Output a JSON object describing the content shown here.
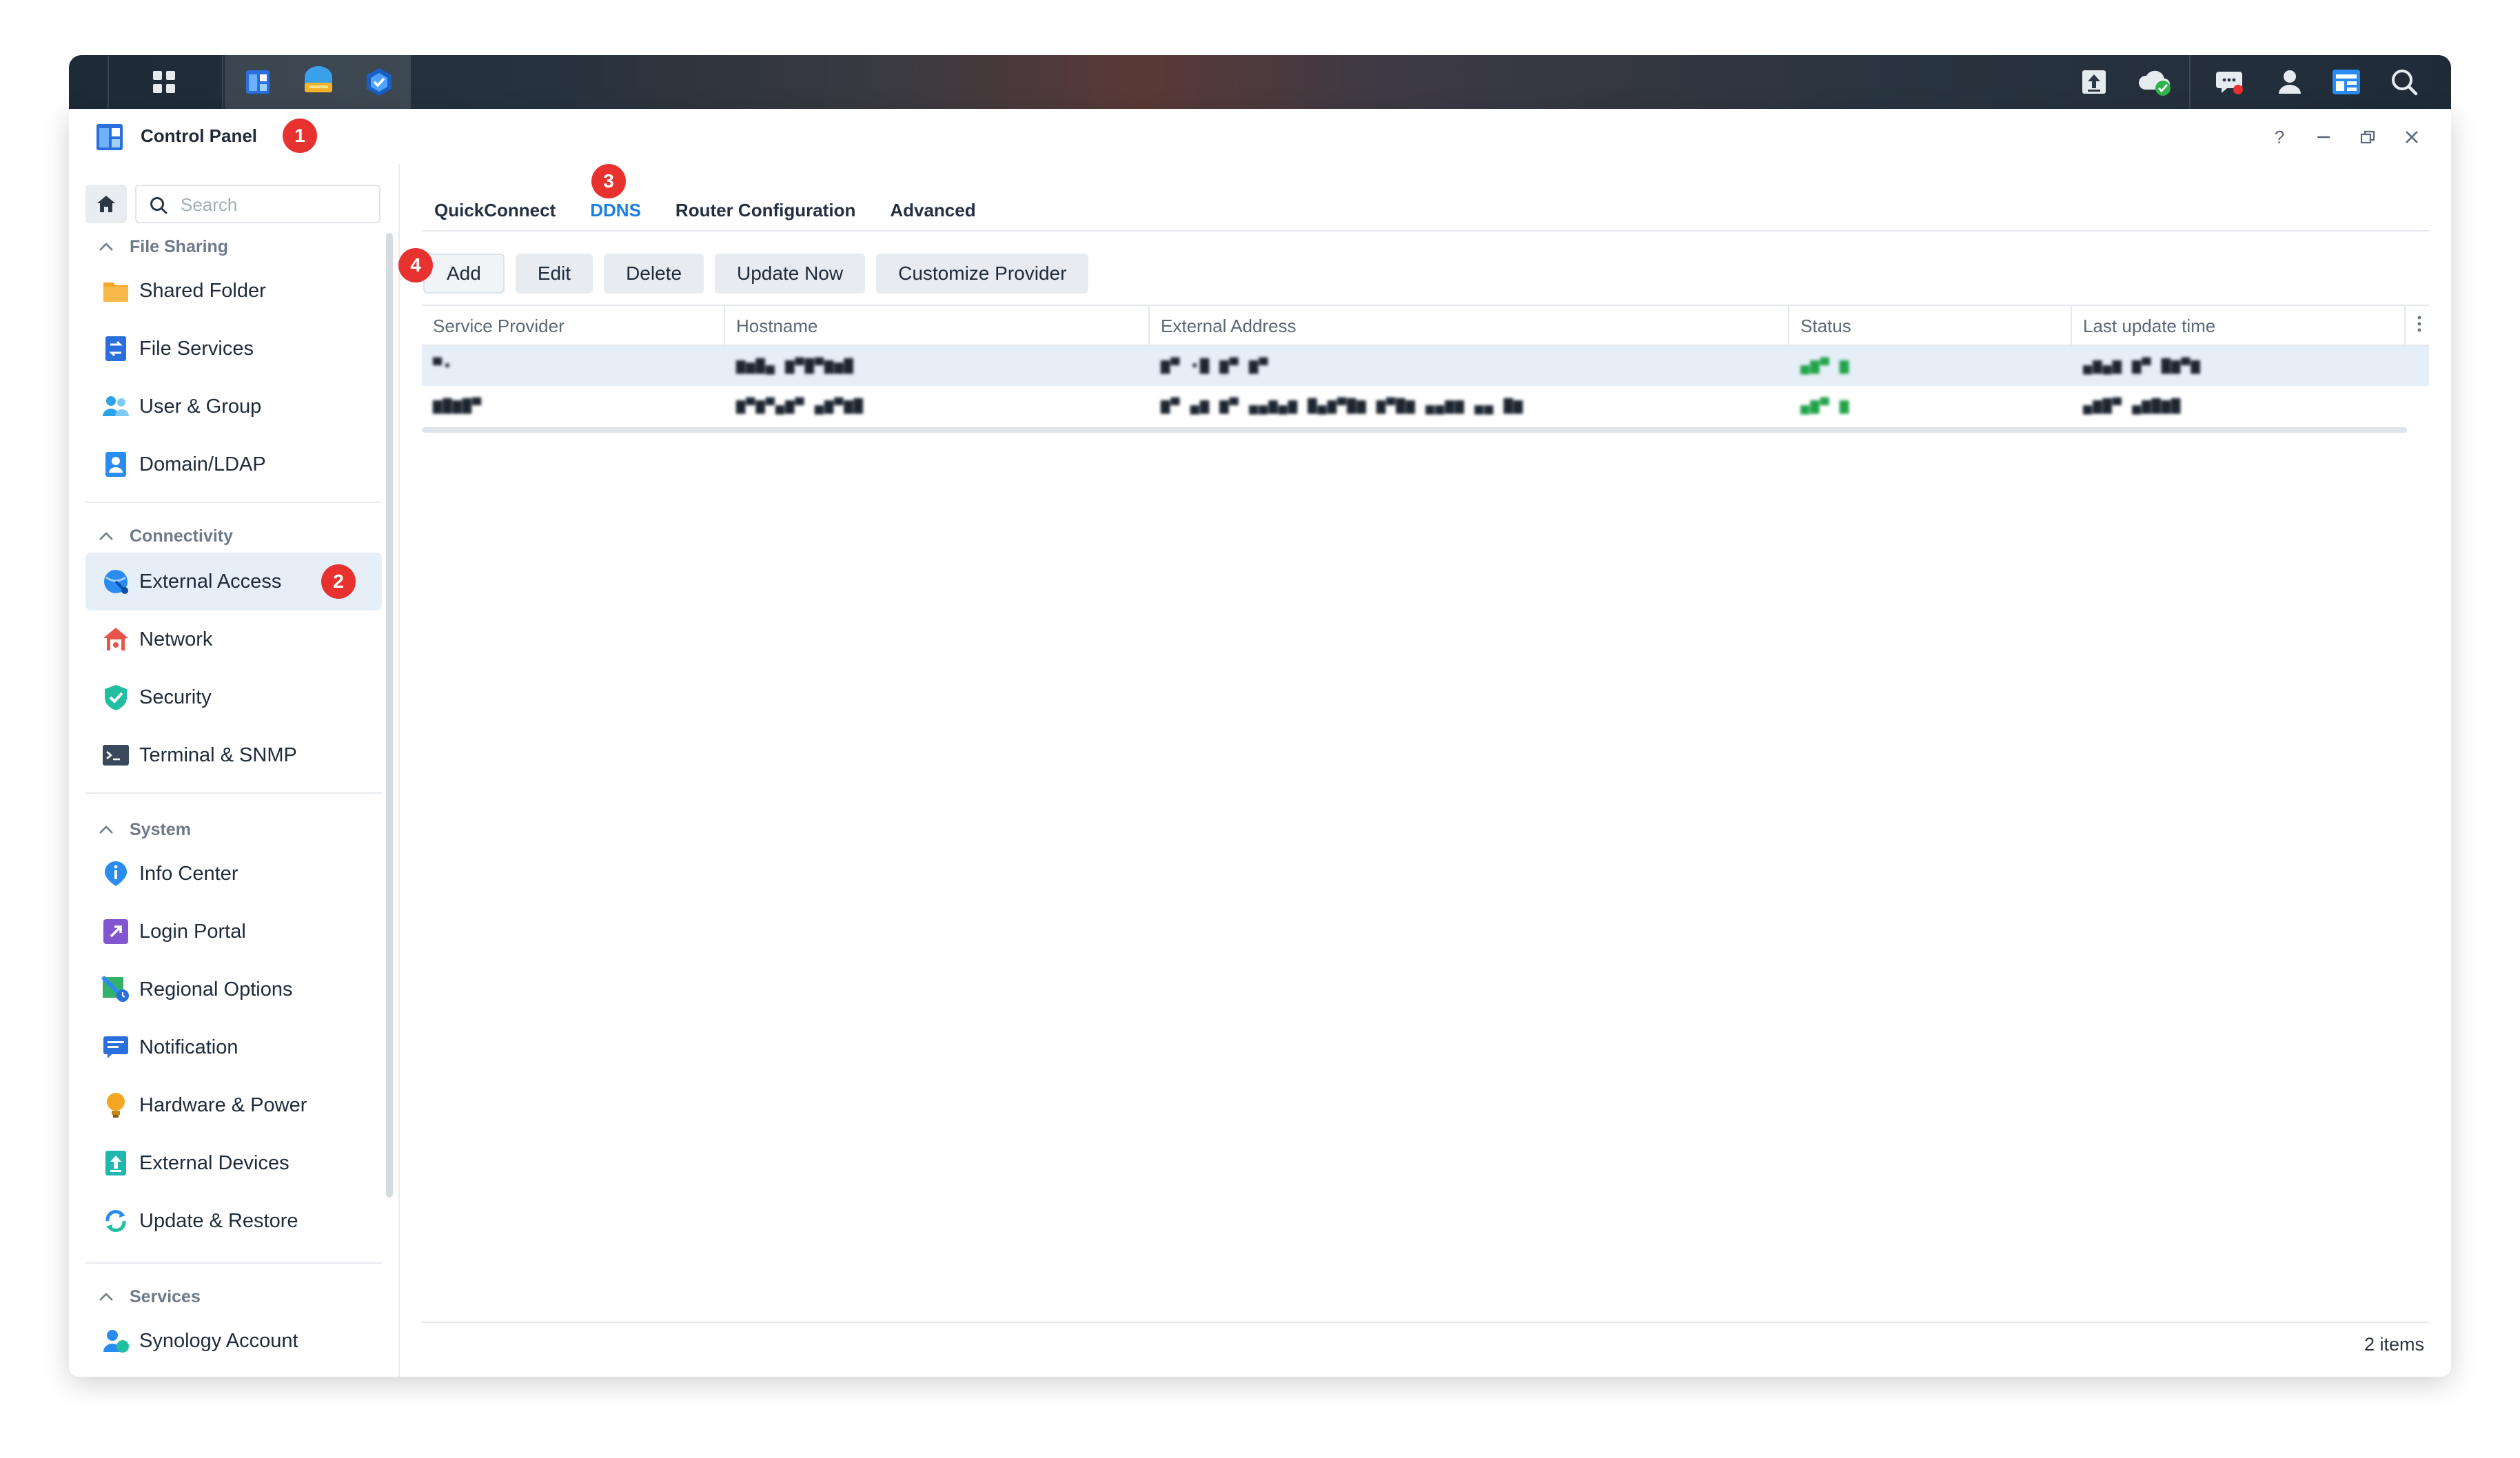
{
  "taskbar": {
    "left_icons": [
      "apps-grid-icon",
      "control-panel-icon",
      "file-station-icon",
      "security-advisor-icon"
    ],
    "right_icons": [
      "upload-icon",
      "cloud-sync-icon",
      "notifications-icon",
      "user-icon",
      "widgets-icon",
      "search-icon"
    ]
  },
  "window": {
    "title": "Control Panel",
    "controls": {
      "help": "?",
      "minimize": "—",
      "restore": "❐",
      "close": "✕"
    }
  },
  "annotations": {
    "badge_1": "1",
    "badge_2": "2",
    "badge_3": "3",
    "badge_4": "4"
  },
  "sidebar": {
    "search_placeholder": "Search",
    "sections": [
      {
        "title": "File Sharing",
        "items": [
          "Shared Folder",
          "File Services",
          "User & Group",
          "Domain/LDAP"
        ]
      },
      {
        "title": "Connectivity",
        "items": [
          "External Access",
          "Network",
          "Security",
          "Terminal & SNMP"
        ]
      },
      {
        "title": "System",
        "items": [
          "Info Center",
          "Login Portal",
          "Regional Options",
          "Notification",
          "Hardware & Power",
          "External Devices",
          "Update & Restore"
        ]
      },
      {
        "title": "Services",
        "items": [
          "Synology Account"
        ]
      }
    ],
    "active_item": "External Access"
  },
  "main": {
    "tabs": [
      "QuickConnect",
      "DDNS",
      "Router Configuration",
      "Advanced"
    ],
    "active_tab": "DDNS",
    "toolbar": [
      "Add",
      "Edit",
      "Delete",
      "Update Now",
      "Customize Provider"
    ],
    "table": {
      "columns": [
        "Service Provider",
        "Hostname",
        "External Address",
        "Status",
        "Last update time"
      ],
      "rows": [
        [
          "▀▪",
          "▆▅▇▄ ▆▀▇▀▆▅▇",
          "▆▀ ▪▇ ▆▀ ▆▀",
          "▄▆▀ ▆",
          "▄▆▄▆ ▆▀ ▇▆▀▆"
        ],
        [
          "▆▇▆▇▀",
          "▆▀▆▀▄▆▀ ▄▆▀▆▇",
          "▆▀ ▄▆ ▆▀ ▄▄▆▄▆ ▇▄▆▀▇▆ ▆▀▇▆ ▄▄▆▆   ▄▄ ▇▆",
          "▄▆▀ ▆",
          "▄▆▇▀ ▄▆▇▆▇"
        ]
      ]
    },
    "footer": {
      "count": "2 items"
    }
  },
  "colors": {
    "accent": "#1a7fe0",
    "badge": "#e8322f",
    "selection": "#e6eef8"
  }
}
